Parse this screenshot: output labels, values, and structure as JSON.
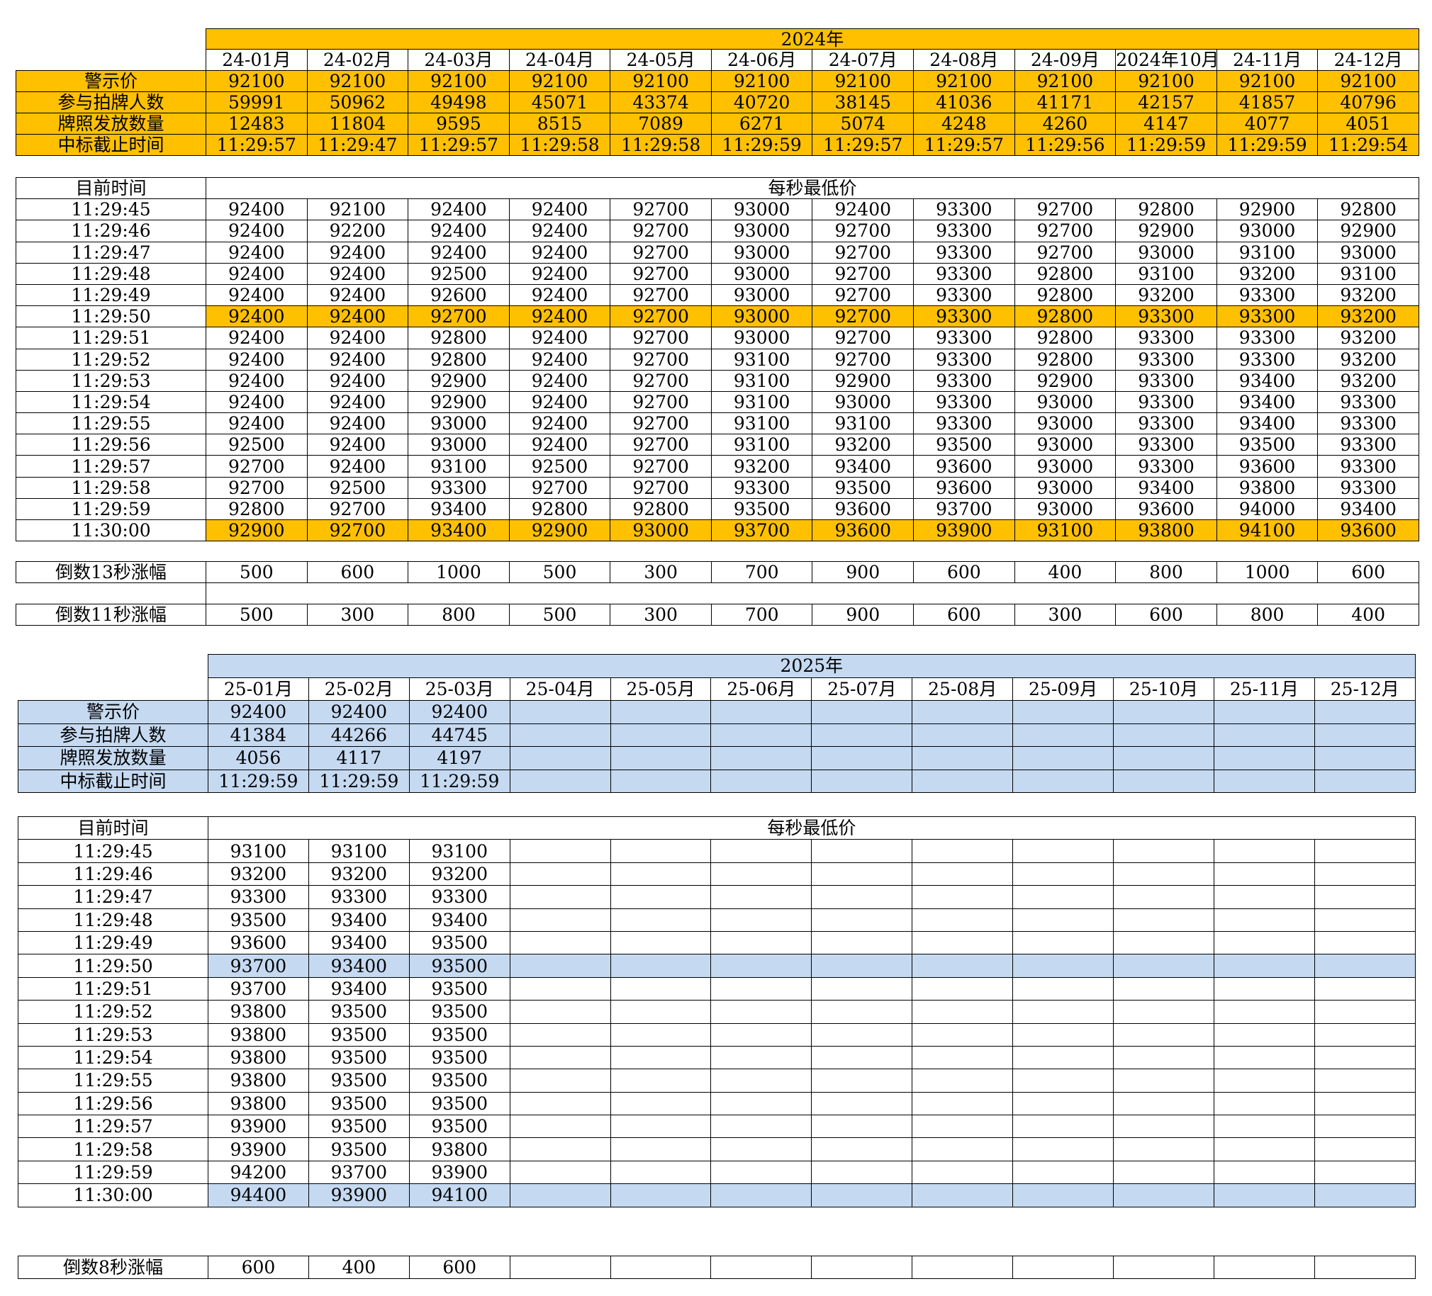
{
  "y2024": {
    "year": "2024年",
    "months": [
      "24-01月",
      "24-02月",
      "24-03月",
      "24-04月",
      "24-05月",
      "24-06月",
      "24-07月",
      "24-08月",
      "24-09月",
      "2024年10月",
      "24-11月",
      "24-12月"
    ],
    "summary": [
      {
        "label": "警示价",
        "values": [
          "92100",
          "92100",
          "92100",
          "92100",
          "92100",
          "92100",
          "92100",
          "92100",
          "92100",
          "92100",
          "92100",
          "92100"
        ]
      },
      {
        "label": "参与拍牌人数",
        "values": [
          "59991",
          "50962",
          "49498",
          "45071",
          "43374",
          "40720",
          "38145",
          "41036",
          "41171",
          "42157",
          "41857",
          "40796"
        ]
      },
      {
        "label": "牌照发放数量",
        "values": [
          "12483",
          "11804",
          "9595",
          "8515",
          "7089",
          "6271",
          "5074",
          "4248",
          "4260",
          "4147",
          "4077",
          "4051"
        ]
      },
      {
        "label": "中标截止时间",
        "values": [
          "11:29:57",
          "11:29:47",
          "11:29:57",
          "11:29:58",
          "11:29:58",
          "11:29:59",
          "11:29:57",
          "11:29:57",
          "11:29:56",
          "11:29:59",
          "11:29:59",
          "11:29:54"
        ]
      }
    ],
    "time_header": "目前时间",
    "price_header": "每秒最低价",
    "rows": [
      {
        "time": "11:29:45",
        "values": [
          "92400",
          "92100",
          "92400",
          "92400",
          "92700",
          "93000",
          "92400",
          "93300",
          "92700",
          "92800",
          "92900",
          "92800"
        ]
      },
      {
        "time": "11:29:46",
        "values": [
          "92400",
          "92200",
          "92400",
          "92400",
          "92700",
          "93000",
          "92700",
          "93300",
          "92700",
          "92900",
          "93000",
          "92900"
        ]
      },
      {
        "time": "11:29:47",
        "values": [
          "92400",
          "92400",
          "92400",
          "92400",
          "92700",
          "93000",
          "92700",
          "93300",
          "92700",
          "93000",
          "93100",
          "93000"
        ]
      },
      {
        "time": "11:29:48",
        "values": [
          "92400",
          "92400",
          "92500",
          "92400",
          "92700",
          "93000",
          "92700",
          "93300",
          "92800",
          "93100",
          "93200",
          "93100"
        ]
      },
      {
        "time": "11:29:49",
        "values": [
          "92400",
          "92400",
          "92600",
          "92400",
          "92700",
          "93000",
          "92700",
          "93300",
          "92800",
          "93200",
          "93300",
          "93200"
        ]
      },
      {
        "time": "11:29:50",
        "values": [
          "92400",
          "92400",
          "92700",
          "92400",
          "92700",
          "93000",
          "92700",
          "93300",
          "92800",
          "93300",
          "93300",
          "93200"
        ],
        "highlight": true
      },
      {
        "time": "11:29:51",
        "values": [
          "92400",
          "92400",
          "92800",
          "92400",
          "92700",
          "93000",
          "92700",
          "93300",
          "92800",
          "93300",
          "93300",
          "93200"
        ]
      },
      {
        "time": "11:29:52",
        "values": [
          "92400",
          "92400",
          "92800",
          "92400",
          "92700",
          "93100",
          "92700",
          "93300",
          "92800",
          "93300",
          "93300",
          "93200"
        ]
      },
      {
        "time": "11:29:53",
        "values": [
          "92400",
          "92400",
          "92900",
          "92400",
          "92700",
          "93100",
          "92900",
          "93300",
          "92900",
          "93300",
          "93400",
          "93200"
        ]
      },
      {
        "time": "11:29:54",
        "values": [
          "92400",
          "92400",
          "92900",
          "92400",
          "92700",
          "93100",
          "93000",
          "93300",
          "93000",
          "93300",
          "93400",
          "93300"
        ]
      },
      {
        "time": "11:29:55",
        "values": [
          "92400",
          "92400",
          "93000",
          "92400",
          "92700",
          "93100",
          "93100",
          "93300",
          "93000",
          "93300",
          "93400",
          "93300"
        ]
      },
      {
        "time": "11:29:56",
        "values": [
          "92500",
          "92400",
          "93000",
          "92400",
          "92700",
          "93100",
          "93200",
          "93500",
          "93000",
          "93300",
          "93500",
          "93300"
        ]
      },
      {
        "time": "11:29:57",
        "values": [
          "92700",
          "92400",
          "93100",
          "92500",
          "92700",
          "93200",
          "93400",
          "93600",
          "93000",
          "93300",
          "93600",
          "93300"
        ]
      },
      {
        "time": "11:29:58",
        "values": [
          "92700",
          "92500",
          "93300",
          "92700",
          "92700",
          "93300",
          "93500",
          "93600",
          "93000",
          "93400",
          "93800",
          "93300"
        ]
      },
      {
        "time": "11:29:59",
        "values": [
          "92800",
          "92700",
          "93400",
          "92800",
          "92800",
          "93500",
          "93600",
          "93700",
          "93000",
          "93600",
          "94000",
          "93400"
        ]
      },
      {
        "time": "11:30:00",
        "values": [
          "92900",
          "92700",
          "93400",
          "92900",
          "93000",
          "93700",
          "93600",
          "93900",
          "93100",
          "93800",
          "94100",
          "93600"
        ],
        "highlight": true
      }
    ],
    "increase13": {
      "label": "倒数13秒涨幅",
      "values": [
        "500",
        "600",
        "1000",
        "500",
        "300",
        "700",
        "900",
        "600",
        "400",
        "800",
        "1000",
        "600"
      ]
    },
    "increase11": {
      "label": "倒数11秒涨幅",
      "values": [
        "500",
        "300",
        "800",
        "500",
        "300",
        "700",
        "900",
        "600",
        "300",
        "600",
        "800",
        "400"
      ]
    }
  },
  "y2025": {
    "year": "2025年",
    "months": [
      "25-01月",
      "25-02月",
      "25-03月",
      "25-04月",
      "25-05月",
      "25-06月",
      "25-07月",
      "25-08月",
      "25-09月",
      "25-10月",
      "25-11月",
      "25-12月"
    ],
    "summary": [
      {
        "label": "警示价",
        "values": [
          "92400",
          "92400",
          "92400",
          "",
          "",
          "",
          "",
          "",
          "",
          "",
          "",
          ""
        ]
      },
      {
        "label": "参与拍牌人数",
        "values": [
          "41384",
          "44266",
          "44745",
          "",
          "",
          "",
          "",
          "",
          "",
          "",
          "",
          ""
        ]
      },
      {
        "label": "牌照发放数量",
        "values": [
          "4056",
          "4117",
          "4197",
          "",
          "",
          "",
          "",
          "",
          "",
          "",
          "",
          ""
        ]
      },
      {
        "label": "中标截止时间",
        "values": [
          "11:29:59",
          "11:29:59",
          "11:29:59",
          "",
          "",
          "",
          "",
          "",
          "",
          "",
          "",
          ""
        ]
      }
    ],
    "time_header": "目前时间",
    "price_header": "每秒最低价",
    "rows": [
      {
        "time": "11:29:45",
        "values": [
          "93100",
          "93100",
          "93100",
          "",
          "",
          "",
          "",
          "",
          "",
          "",
          "",
          ""
        ]
      },
      {
        "time": "11:29:46",
        "values": [
          "93200",
          "93200",
          "93200",
          "",
          "",
          "",
          "",
          "",
          "",
          "",
          "",
          ""
        ]
      },
      {
        "time": "11:29:47",
        "values": [
          "93300",
          "93300",
          "93300",
          "",
          "",
          "",
          "",
          "",
          "",
          "",
          "",
          ""
        ]
      },
      {
        "time": "11:29:48",
        "values": [
          "93500",
          "93400",
          "93400",
          "",
          "",
          "",
          "",
          "",
          "",
          "",
          "",
          ""
        ]
      },
      {
        "time": "11:29:49",
        "values": [
          "93600",
          "93400",
          "93500",
          "",
          "",
          "",
          "",
          "",
          "",
          "",
          "",
          ""
        ]
      },
      {
        "time": "11:29:50",
        "values": [
          "93700",
          "93400",
          "93500",
          "",
          "",
          "",
          "",
          "",
          "",
          "",
          "",
          ""
        ],
        "highlight": true
      },
      {
        "time": "11:29:51",
        "values": [
          "93700",
          "93400",
          "93500",
          "",
          "",
          "",
          "",
          "",
          "",
          "",
          "",
          ""
        ]
      },
      {
        "time": "11:29:52",
        "values": [
          "93800",
          "93500",
          "93500",
          "",
          "",
          "",
          "",
          "",
          "",
          "",
          "",
          ""
        ]
      },
      {
        "time": "11:29:53",
        "values": [
          "93800",
          "93500",
          "93500",
          "",
          "",
          "",
          "",
          "",
          "",
          "",
          "",
          ""
        ]
      },
      {
        "time": "11:29:54",
        "values": [
          "93800",
          "93500",
          "93500",
          "",
          "",
          "",
          "",
          "",
          "",
          "",
          "",
          ""
        ]
      },
      {
        "time": "11:29:55",
        "values": [
          "93800",
          "93500",
          "93500",
          "",
          "",
          "",
          "",
          "",
          "",
          "",
          "",
          ""
        ]
      },
      {
        "time": "11:29:56",
        "values": [
          "93800",
          "93500",
          "93500",
          "",
          "",
          "",
          "",
          "",
          "",
          "",
          "",
          ""
        ]
      },
      {
        "time": "11:29:57",
        "values": [
          "93900",
          "93500",
          "93500",
          "",
          "",
          "",
          "",
          "",
          "",
          "",
          "",
          ""
        ]
      },
      {
        "time": "11:29:58",
        "values": [
          "93900",
          "93500",
          "93800",
          "",
          "",
          "",
          "",
          "",
          "",
          "",
          "",
          ""
        ]
      },
      {
        "time": "11:29:59",
        "values": [
          "94200",
          "93700",
          "93900",
          "",
          "",
          "",
          "",
          "",
          "",
          "",
          "",
          ""
        ]
      },
      {
        "time": "11:30:00",
        "values": [
          "94400",
          "93900",
          "94100",
          "",
          "",
          "",
          "",
          "",
          "",
          "",
          "",
          ""
        ],
        "highlight": true
      }
    ],
    "increase8": {
      "label": "倒数8秒涨幅",
      "values": [
        "600",
        "400",
        "600",
        "",
        "",
        "",
        "",
        "",
        "",
        "",
        "",
        ""
      ]
    }
  },
  "colors": {
    "highlight_2024": "#FFC000",
    "highlight_2025": "#C5D9F1",
    "grid": "#000000"
  }
}
